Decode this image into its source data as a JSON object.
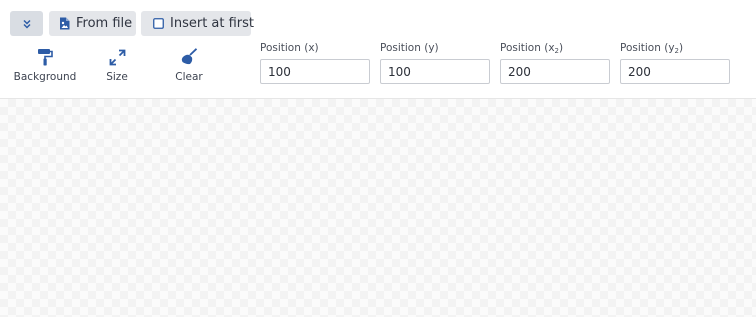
{
  "toolbar": {
    "collapse_icon": "chevron-double-down-icon",
    "from_file_label": "From file",
    "from_file_icon": "file-image-icon",
    "insert_first_label": "Insert at first",
    "insert_first_icon": "checkbox-icon",
    "insert_first_checked": false
  },
  "tools": {
    "background_label": "Background",
    "background_icon": "paint-roller-icon",
    "size_label": "Size",
    "size_icon": "expand-icon",
    "clear_label": "Clear",
    "clear_icon": "broom-icon"
  },
  "position": {
    "x_label": "Position (x)",
    "x_value": "100",
    "y_label": "Position (y)",
    "y_value": "100",
    "x2_label_main": "Position (x",
    "x2_label_sub": "2",
    "x2_label_end": ")",
    "x2_value": "200",
    "y2_label_main": "Position (y",
    "y2_label_sub": "2",
    "y2_label_end": ")",
    "y2_value": "200"
  },
  "colors": {
    "accent": "#2d5ca6",
    "button_bg": "#e4e6ea"
  }
}
